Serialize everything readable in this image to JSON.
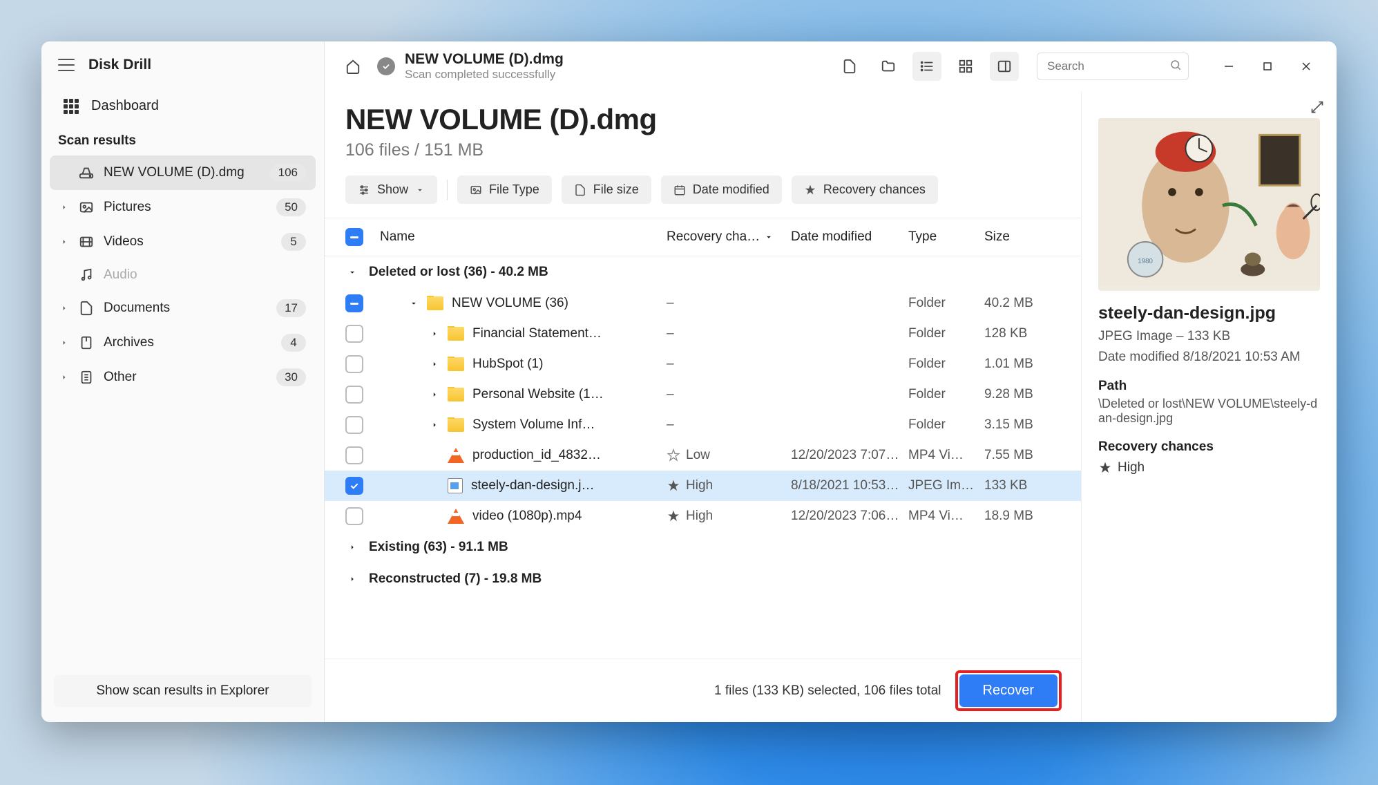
{
  "app_title": "Disk Drill",
  "sidebar": {
    "dashboard_label": "Dashboard",
    "section_label": "Scan results",
    "items": [
      {
        "label": "NEW VOLUME (D).dmg",
        "count": "106",
        "icon": "drive",
        "active": true,
        "expandable": false
      },
      {
        "label": "Pictures",
        "count": "50",
        "icon": "image",
        "expandable": true
      },
      {
        "label": "Videos",
        "count": "5",
        "icon": "video",
        "expandable": true
      },
      {
        "label": "Audio",
        "count": "",
        "icon": "audio",
        "expandable": false,
        "muted": true
      },
      {
        "label": "Documents",
        "count": "17",
        "icon": "doc",
        "expandable": true
      },
      {
        "label": "Archives",
        "count": "4",
        "icon": "archive",
        "expandable": true
      },
      {
        "label": "Other",
        "count": "30",
        "icon": "other",
        "expandable": true
      }
    ],
    "footer_button": "Show scan results in Explorer"
  },
  "topbar": {
    "title": "NEW VOLUME (D).dmg",
    "subtitle": "Scan completed successfully",
    "search_placeholder": "Search"
  },
  "header": {
    "volume_title": "NEW VOLUME (D).dmg",
    "volume_sub": "106 files / 151 MB"
  },
  "filters": {
    "show": "Show",
    "file_type": "File Type",
    "file_size": "File size",
    "date_modified": "Date modified",
    "recovery_chances": "Recovery chances"
  },
  "columns": {
    "name": "Name",
    "recovery": "Recovery cha…",
    "date": "Date modified",
    "type": "Type",
    "size": "Size"
  },
  "groups": {
    "deleted": "Deleted or lost (36) - 40.2 MB",
    "existing": "Existing (63) - 91.1 MB",
    "reconstructed": "Reconstructed (7) - 19.8 MB"
  },
  "rows": [
    {
      "name": "NEW VOLUME (36)",
      "rec": "–",
      "date": "",
      "type": "Folder",
      "size": "40.2 MB",
      "indent": 1,
      "chk": "ind",
      "ico": "folder",
      "exp": true
    },
    {
      "name": "Financial Statement…",
      "rec": "–",
      "date": "",
      "type": "Folder",
      "size": "128 KB",
      "indent": 2,
      "chk": "",
      "ico": "folder",
      "exp": true
    },
    {
      "name": "HubSpot (1)",
      "rec": "–",
      "date": "",
      "type": "Folder",
      "size": "1.01 MB",
      "indent": 2,
      "chk": "",
      "ico": "folder",
      "exp": true
    },
    {
      "name": "Personal Website (1…",
      "rec": "–",
      "date": "",
      "type": "Folder",
      "size": "9.28 MB",
      "indent": 2,
      "chk": "",
      "ico": "folder",
      "exp": true
    },
    {
      "name": "System Volume Inf…",
      "rec": "–",
      "date": "",
      "type": "Folder",
      "size": "3.15 MB",
      "indent": 2,
      "chk": "",
      "ico": "folder",
      "exp": true
    },
    {
      "name": "production_id_4832…",
      "rec": "Low",
      "date": "12/20/2023 7:07…",
      "type": "MP4 Vi…",
      "size": "7.55 MB",
      "indent": 2,
      "chk": "",
      "ico": "vlc",
      "star": "empty"
    },
    {
      "name": "steely-dan-design.j…",
      "rec": "High",
      "date": "8/18/2021 10:53…",
      "type": "JPEG Im…",
      "size": "133 KB",
      "indent": 2,
      "chk": "ck",
      "ico": "img",
      "star": "full",
      "sel": true
    },
    {
      "name": "video (1080p).mp4",
      "rec": "High",
      "date": "12/20/2023 7:06…",
      "type": "MP4 Vi…",
      "size": "18.9 MB",
      "indent": 2,
      "chk": "",
      "ico": "vlc",
      "star": "full"
    }
  ],
  "preview": {
    "title": "steely-dan-design.jpg",
    "meta1": "JPEG Image – 133 KB",
    "meta2": "Date modified 8/18/2021 10:53 AM",
    "path_h": "Path",
    "path": "\\Deleted or lost\\NEW VOLUME\\steely-dan-design.jpg",
    "rc_h": "Recovery chances",
    "rc": "High"
  },
  "statusbar": {
    "text": "1 files (133 KB) selected, 106 files total",
    "recover": "Recover"
  }
}
